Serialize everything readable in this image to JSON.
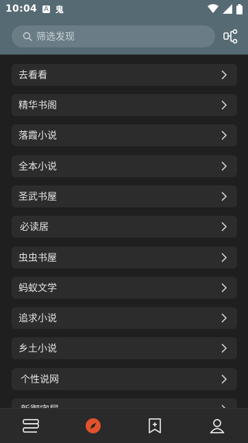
{
  "status_bar": {
    "time": "10:04",
    "app_badge_1": "A",
    "app_badge_2": "鬼"
  },
  "search": {
    "placeholder": "筛选发现"
  },
  "sources": [
    {
      "label": "去看看"
    },
    {
      "label": "精华书阁"
    },
    {
      "label": "落霞小说"
    },
    {
      "label": "全本小说"
    },
    {
      "label": "圣武书屋"
    },
    {
      "label": "必读居"
    },
    {
      "label": "虫虫书屋"
    },
    {
      "label": "蚂蚁文学"
    },
    {
      "label": "追求小说"
    },
    {
      "label": "乡土小说"
    },
    {
      "label": "个性说网"
    },
    {
      "label": "新御宅屋"
    }
  ],
  "bottom_nav": [
    {
      "icon": "bookshelf-icon"
    },
    {
      "icon": "compass-icon",
      "active": true
    },
    {
      "icon": "bookmark-add-icon"
    },
    {
      "icon": "profile-icon"
    }
  ],
  "colors": {
    "header": "#566a73",
    "accent": "#e0522d",
    "background": "#1f1f1f",
    "item": "#2c2c2c"
  }
}
